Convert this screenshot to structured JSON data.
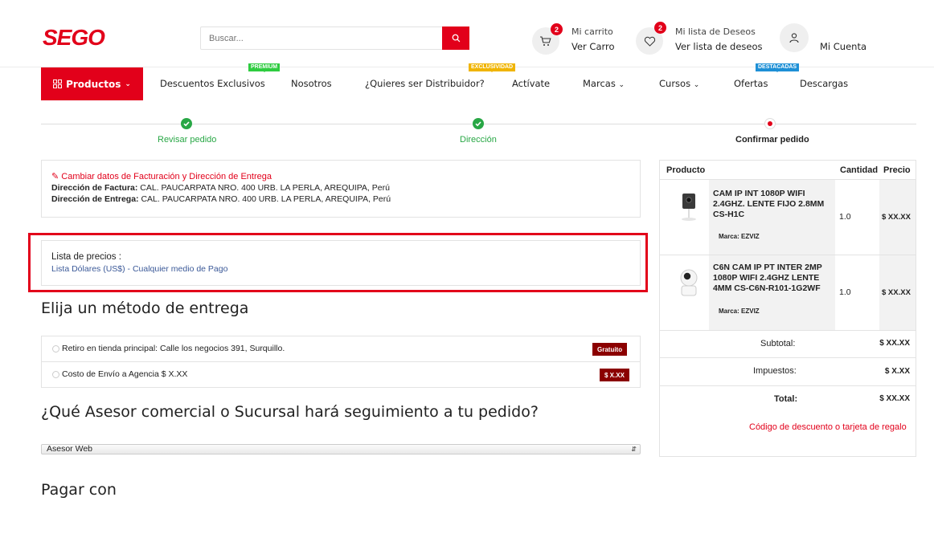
{
  "header": {
    "logo_text": "SEGO",
    "search_placeholder": "Buscar...",
    "cart": {
      "badge": "2",
      "title": "Mi carrito",
      "link": "Ver Carro"
    },
    "wishlist": {
      "badge": "2",
      "title": "Mi lista de Deseos",
      "link": "Ver lista de deseos"
    },
    "account": {
      "label": "Mi Cuenta"
    }
  },
  "nav": {
    "products": "Productos",
    "items": [
      {
        "label": "Descuentos Exclusivos",
        "tag": "PREMIUM",
        "tag_color": "#2ecc40"
      },
      {
        "label": "Nosotros"
      },
      {
        "label": "¿Quieres ser Distribuidor?",
        "tag": "EXCLUSIVIDAD",
        "tag_color": "#f0b400"
      },
      {
        "label": "Actívate"
      },
      {
        "label": "Marcas"
      },
      {
        "label": "Cursos"
      },
      {
        "label": "Ofertas",
        "tag": "DESTACADAS",
        "tag_color": "#1e90d6"
      },
      {
        "label": "Descargas"
      }
    ]
  },
  "steps": [
    {
      "label": "Revisar pedido",
      "state": "done"
    },
    {
      "label": "Dirección",
      "state": "done"
    },
    {
      "label": "Confirmar pedido",
      "state": "current"
    }
  ],
  "address": {
    "change_link": "Cambiar datos de Facturación y Dirección de Entrega",
    "billing_label": "Dirección de Factura:",
    "billing_value": "CAL. PAUCARPATA NRO. 400 URB. LA PERLA, AREQUIPA, Perú",
    "shipping_label": "Dirección de Entrega:",
    "shipping_value": "CAL. PAUCARPATA NRO. 400 URB. LA PERLA, AREQUIPA, Perú"
  },
  "price_list": {
    "title": "Lista de precios :",
    "value": "Lista Dólares (US$) - Cualquier medio de Pago"
  },
  "delivery": {
    "title": "Elija un método de entrega",
    "options": [
      {
        "label": "Retiro en tienda principal: Calle los negocios 391, Surquillo.",
        "tag": "Gratuito"
      },
      {
        "label": "Costo de Envío a Agencia $ X.XX",
        "tag": "$ X.XX"
      }
    ]
  },
  "advisor": {
    "title": "¿Qué Asesor comercial o Sucursal hará seguimiento a tu pedido?",
    "selected": "Asesor Web"
  },
  "payment": {
    "title": "Pagar con"
  },
  "summary": {
    "headers": {
      "product": "Producto",
      "qty": "Cantidad",
      "price": "Precio"
    },
    "products": [
      {
        "name": "CAM IP INT 1080P WIFI 2.4GHZ. LENTE FIJO 2.8MM CS-H1C",
        "brand": "Marca: EZVIZ",
        "qty": "1.0",
        "price": "$ XX.XX"
      },
      {
        "name": "C6N CAM IP PT INTER 2MP 1080P WIFI 2.4GHZ LENTE 4MM CS-C6N-R101-1G2WF",
        "brand": "Marca: EZVIZ",
        "qty": "1.0",
        "price": "$ XX.XX"
      }
    ],
    "subtotal_label": "Subtotal:",
    "subtotal_value": "$ XX.XX",
    "tax_label": "Impuestos:",
    "tax_value": "$ X.XX",
    "total_label": "Total:",
    "total_value": "$ XX.XX",
    "discount_link": "Código de descuento o tarjeta de regalo"
  }
}
